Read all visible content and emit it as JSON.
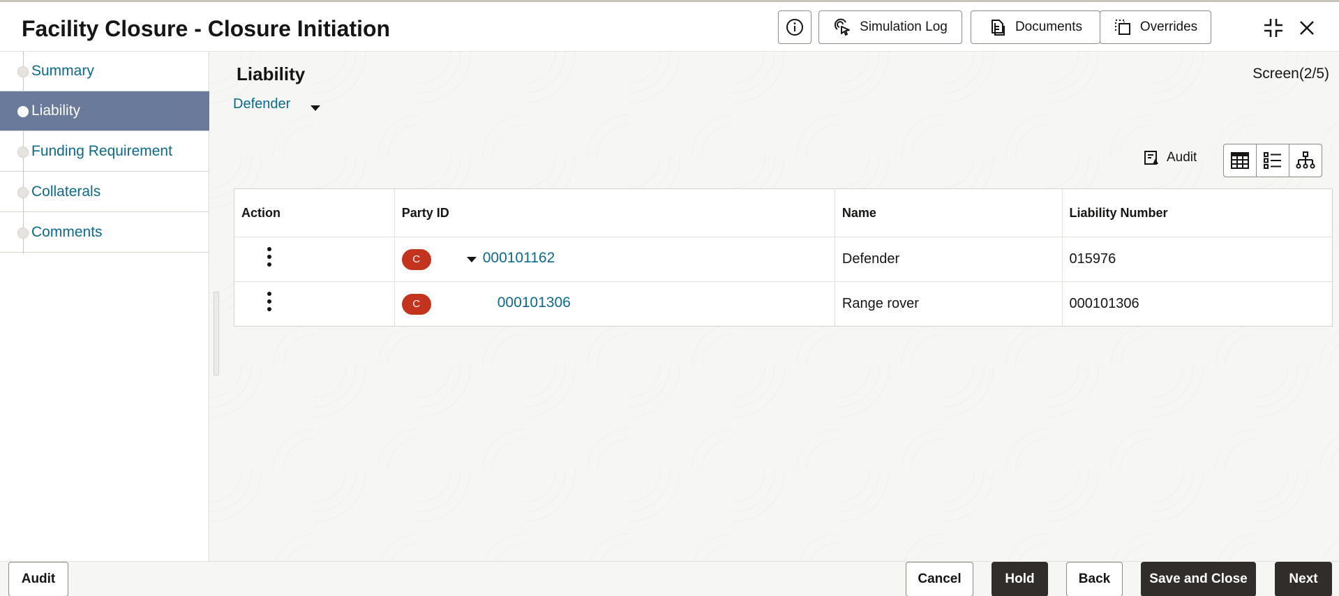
{
  "header": {
    "title": "Facility Closure - Closure Initiation",
    "buttons": {
      "simulation_log": "Simulation Log",
      "documents": "Documents",
      "overrides": "Overrides"
    }
  },
  "sidebar": {
    "items": [
      {
        "label": "Summary",
        "active": false
      },
      {
        "label": "Liability",
        "active": true
      },
      {
        "label": "Funding Requirement",
        "active": false
      },
      {
        "label": "Collaterals",
        "active": false
      },
      {
        "label": "Comments",
        "active": false
      }
    ]
  },
  "main": {
    "section_title": "Liability",
    "screen_indicator": "Screen(2/5)",
    "selector_value": "Defender",
    "audit_label": "Audit",
    "table": {
      "headers": [
        "Action",
        "Party ID",
        "Name",
        "Liability Number"
      ],
      "rows": [
        {
          "badge": "C",
          "party_id": "000101162",
          "name": "Defender",
          "liability_number": "015976",
          "expanded": true
        },
        {
          "badge": "C",
          "party_id": "000101306",
          "name": "Range rover",
          "liability_number": "000101306",
          "expanded": false
        }
      ]
    }
  },
  "footer": {
    "audit": "Audit",
    "cancel": "Cancel",
    "hold": "Hold",
    "back": "Back",
    "save_and_close": "Save and Close",
    "next": "Next"
  },
  "colors": {
    "link": "#0b6a8c",
    "active_nav": "#6a7a9a",
    "badge": "#c3331d",
    "dark_button": "#312d2a"
  }
}
